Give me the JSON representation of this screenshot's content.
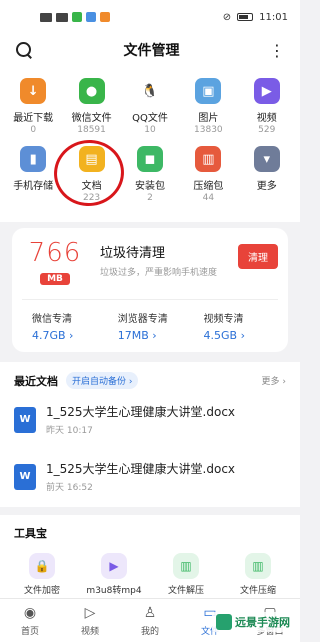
{
  "status": {
    "time": "11:01"
  },
  "header": {
    "title": "文件管理",
    "more": "⋮"
  },
  "categories": [
    {
      "label": "最近下载",
      "count": "0",
      "icon": "download-icon",
      "color": "#f08a2b",
      "glyph": "↓"
    },
    {
      "label": "微信文件",
      "count": "18591",
      "icon": "wechat-icon",
      "color": "#39b54a",
      "glyph": "●"
    },
    {
      "label": "QQ文件",
      "count": "10",
      "icon": "qq-icon",
      "color": "#ffffff",
      "glyph": "🐧"
    },
    {
      "label": "图片",
      "count": "13830",
      "icon": "image-icon",
      "color": "#5ba3e0",
      "glyph": "▣"
    },
    {
      "label": "视频",
      "count": "529",
      "icon": "video-icon",
      "color": "#7a5ce6",
      "glyph": "▶"
    },
    {
      "label": "手机存储",
      "count": "",
      "icon": "storage-icon",
      "color": "#5d8fd6",
      "glyph": "▮"
    },
    {
      "label": "文档",
      "count": "223",
      "icon": "document-icon",
      "color": "#f2b21f",
      "glyph": "▤"
    },
    {
      "label": "安装包",
      "count": "2",
      "icon": "apk-icon",
      "color": "#3db865",
      "glyph": "◼"
    },
    {
      "label": "压缩包",
      "count": "44",
      "icon": "archive-icon",
      "color": "#e65a3d",
      "glyph": "▥"
    },
    {
      "label": "更多",
      "count": "",
      "icon": "more-icon",
      "color": "#6f7c99",
      "glyph": "▾"
    }
  ],
  "cleaner": {
    "number": "766",
    "unit": "MB",
    "title": "垃圾待清理",
    "subtitle": "垃圾过多，严重影响手机速度",
    "button": "清理",
    "items": [
      {
        "label": "微信专清",
        "value": "4.7GB ›"
      },
      {
        "label": "浏览器专清",
        "value": "17MB ›"
      },
      {
        "label": "视频专清",
        "value": "4.5GB ›"
      }
    ]
  },
  "recent": {
    "title": "最近文档",
    "backup": "开启自动备份 ›",
    "more": "更多 ›",
    "docs": [
      {
        "name": "1_525大学生心理健康大讲堂.docx",
        "time": "昨天 10:17"
      },
      {
        "name": "1_525大学生心理健康大讲堂.docx",
        "time": "前天 16:52"
      }
    ]
  },
  "tools": {
    "title": "工具宝",
    "items": [
      {
        "label": "文件加密",
        "icon": "lock-icon",
        "bg": "#ede7fb",
        "fg": "#7a5ce6",
        "glyph": "🔒"
      },
      {
        "label": "m3u8转mp4",
        "icon": "convert-icon",
        "bg": "#ede7fb",
        "fg": "#7a5ce6",
        "glyph": "▶"
      },
      {
        "label": "文件解压",
        "icon": "unzip-icon",
        "bg": "#e3f5e8",
        "fg": "#3db865",
        "glyph": "▥"
      },
      {
        "label": "文件压缩",
        "icon": "zip-icon",
        "bg": "#e3f5e8",
        "fg": "#3db865",
        "glyph": "▥"
      }
    ]
  },
  "tabs": [
    {
      "label": "首页",
      "icon": "home-icon",
      "glyph": "◉",
      "active": false
    },
    {
      "label": "视频",
      "icon": "play-icon",
      "glyph": "▷",
      "active": false
    },
    {
      "label": "我的",
      "icon": "user-icon",
      "glyph": "♙",
      "active": false
    },
    {
      "label": "文件",
      "icon": "folder-icon",
      "glyph": "▭",
      "active": true
    },
    {
      "label": "多窗口",
      "icon": "windows-icon",
      "glyph": "▢",
      "active": false
    }
  ],
  "watermark": {
    "text": "远景手游网"
  }
}
